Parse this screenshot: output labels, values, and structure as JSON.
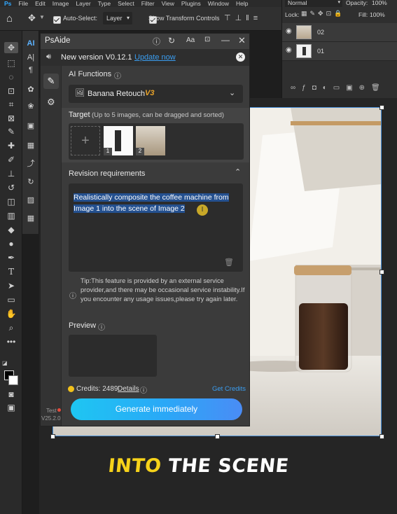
{
  "menubar": {
    "items": [
      "File",
      "Edit",
      "Image",
      "Layer",
      "Type",
      "Select",
      "Filter",
      "View",
      "Plugins",
      "Window",
      "Help"
    ]
  },
  "options_bar": {
    "auto_select_label": "Auto-Select:",
    "auto_select_value": "Layer",
    "show_transform_label": "Show Transform Controls"
  },
  "layers_panel": {
    "blend_mode": "Normal",
    "opacity_label": "Opacity:",
    "opacity_value": "100%",
    "lock_label": "Lock:",
    "fill_label": "Fill:",
    "fill_value": "100%",
    "layers": [
      {
        "name": "02"
      },
      {
        "name": "01"
      }
    ]
  },
  "plugin": {
    "title": "PsAide",
    "font_size_label": "Aa",
    "new_version_text": "New version V0.12.1",
    "update_now": "Update now",
    "ai_functions_label": "AI Functions",
    "function_selected": "Banana Retouch",
    "function_badge": "V3",
    "target_label": "Target",
    "target_hint": "(Up to 5 images, can be dragged and sorted)",
    "target_images": [
      {
        "index": "1"
      },
      {
        "index": "2"
      }
    ],
    "revision_label": "Revision requirements",
    "revision_text_line1": "Realistically composite the coffee machine from",
    "revision_text_line2": "Image 1 into the scene of Image 2",
    "tip_text": "Tip:This feature is provided by an external service provider,and there may be occasional service instability.If you encounter any usage issues,please try again later.",
    "preview_label": "Preview",
    "credits_label": "Credits: 2489",
    "details_link": "Details",
    "get_credits": "Get Credits",
    "generate_button": "Generate immediately"
  },
  "toolbar_footer": {
    "test_label": "Test",
    "version": "V25.2.0"
  },
  "caption": {
    "highlight": "INTO",
    "rest": "THE SCENE"
  },
  "colors": {
    "accent_blue": "#2b8bd8",
    "generate_start": "#1ec6f2",
    "generate_end": "#4a8cf5",
    "caption_yellow": "#f6d21a"
  }
}
